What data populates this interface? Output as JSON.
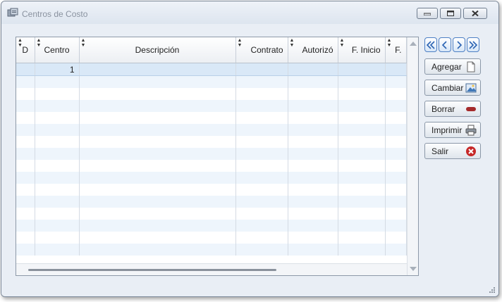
{
  "window": {
    "title": "Centros de Costo"
  },
  "grid": {
    "columns": [
      "D",
      "Centro",
      "Descripción",
      "Contrato",
      "Autorizó",
      "F. Inicio",
      "F."
    ],
    "rows": [
      [
        "",
        "1",
        "",
        "",
        "",
        "",
        ""
      ]
    ]
  },
  "actions": {
    "add_label": "Agregar",
    "change_label": "Cambiar",
    "delete_label": "Borrar",
    "print_label": "Imprimir",
    "exit_label": "Salir"
  },
  "colors": {
    "selected_row": "#d9e8f7",
    "alt_row": "#eef5fc",
    "nav_border": "#4d7fc4",
    "delete_red": "#a52a2a"
  }
}
